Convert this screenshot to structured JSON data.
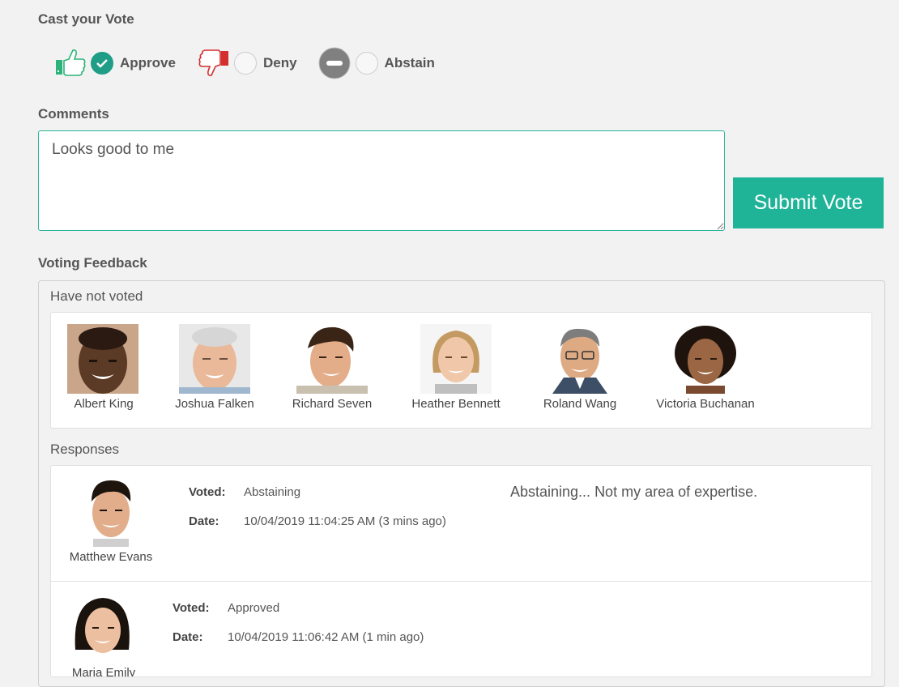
{
  "vote": {
    "title": "Cast your Vote",
    "options": [
      {
        "label": "Approve",
        "icon": "thumbs-up-icon",
        "selected": true
      },
      {
        "label": "Deny",
        "icon": "thumbs-down-icon",
        "selected": false
      },
      {
        "label": "Abstain",
        "icon": "minus-circle-icon",
        "selected": false
      }
    ]
  },
  "comments": {
    "title": "Comments",
    "value": "Looks good to me"
  },
  "submit_label": "Submit Vote",
  "feedback": {
    "title": "Voting Feedback",
    "not_voted_label": "Have not voted",
    "not_voted": [
      {
        "name": "Albert King"
      },
      {
        "name": "Joshua Falken"
      },
      {
        "name": "Richard Seven"
      },
      {
        "name": "Heather Bennett"
      },
      {
        "name": "Roland Wang"
      },
      {
        "name": "Victoria Buchanan"
      }
    ],
    "responses_label": "Responses",
    "responses": [
      {
        "name": "Matthew Evans",
        "voted_label": "Voted:",
        "voted": "Abstaining",
        "date_label": "Date:",
        "date": "10/04/2019 11:04:25 AM (3 mins ago)",
        "comment": "Abstaining... Not my area of expertise."
      },
      {
        "name": "Maria Emily",
        "voted_label": "Voted:",
        "voted": "Approved",
        "date_label": "Date:",
        "date": "10/04/2019 11:06:42 AM (1 min ago)",
        "comment": ""
      }
    ]
  },
  "colors": {
    "accent": "#1fb397",
    "approve_green": "#2db37a",
    "deny_red": "#d32f2f",
    "abstain_gray": "#808080"
  }
}
